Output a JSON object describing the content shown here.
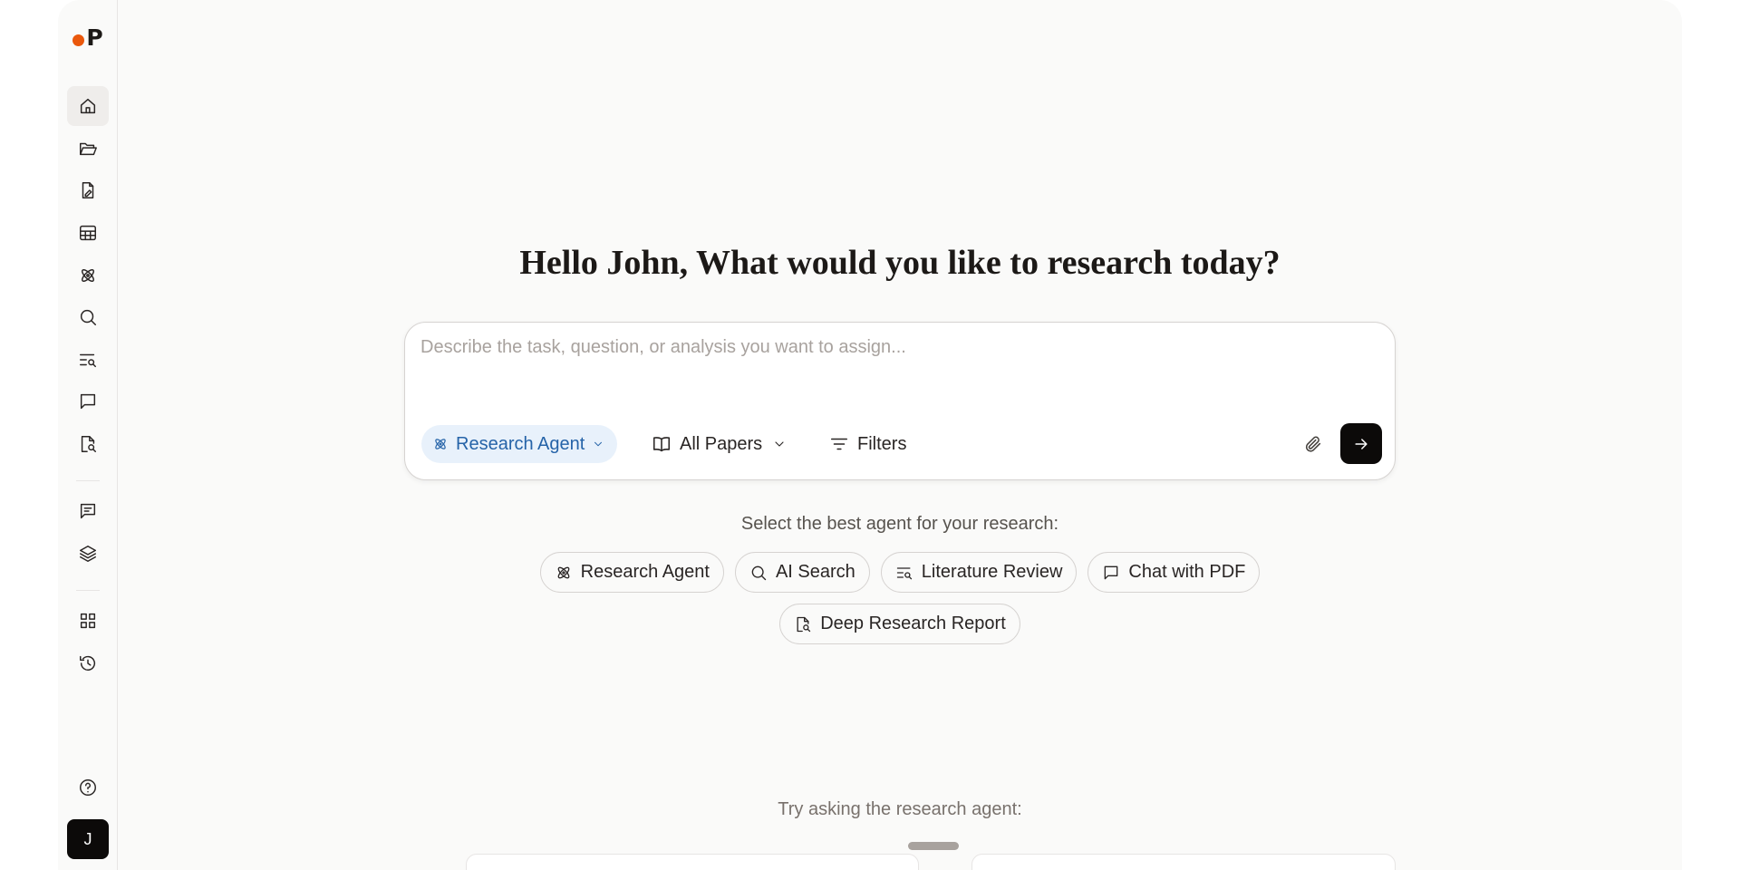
{
  "brand": {
    "logo_letter": "P",
    "accent": "#ea580c"
  },
  "sidebar": {
    "items": [
      {
        "icon": "home-icon",
        "active": true
      },
      {
        "icon": "folder-open-icon"
      },
      {
        "icon": "file-edit-icon"
      },
      {
        "icon": "table-icon"
      },
      {
        "icon": "atom-icon"
      },
      {
        "icon": "search-icon"
      },
      {
        "icon": "list-search-icon"
      },
      {
        "icon": "message-square-icon"
      },
      {
        "icon": "file-search-icon"
      },
      {
        "icon": "message-text-icon"
      },
      {
        "icon": "layers-icon"
      },
      {
        "icon": "grid-icon"
      },
      {
        "icon": "history-icon"
      },
      {
        "icon": "help-circle-icon"
      }
    ],
    "avatar_initial": "J"
  },
  "main": {
    "headline": "Hello John, What would you like to research today?",
    "composer": {
      "placeholder": "Describe the task, question, or analysis you want to assign...",
      "value": "",
      "agent_label": "Research Agent",
      "source_label": "All Papers",
      "filters_label": "Filters"
    },
    "agent_prompt": "Select the best agent for your research:",
    "agents": [
      {
        "label": "Research Agent",
        "icon": "atom-icon"
      },
      {
        "label": "AI Search",
        "icon": "search-icon"
      },
      {
        "label": "Literature Review",
        "icon": "list-search-icon"
      },
      {
        "label": "Chat with PDF",
        "icon": "message-square-icon"
      },
      {
        "label": "Deep Research Report",
        "icon": "file-search-icon"
      }
    ],
    "try_label": "Try asking the research agent:"
  }
}
